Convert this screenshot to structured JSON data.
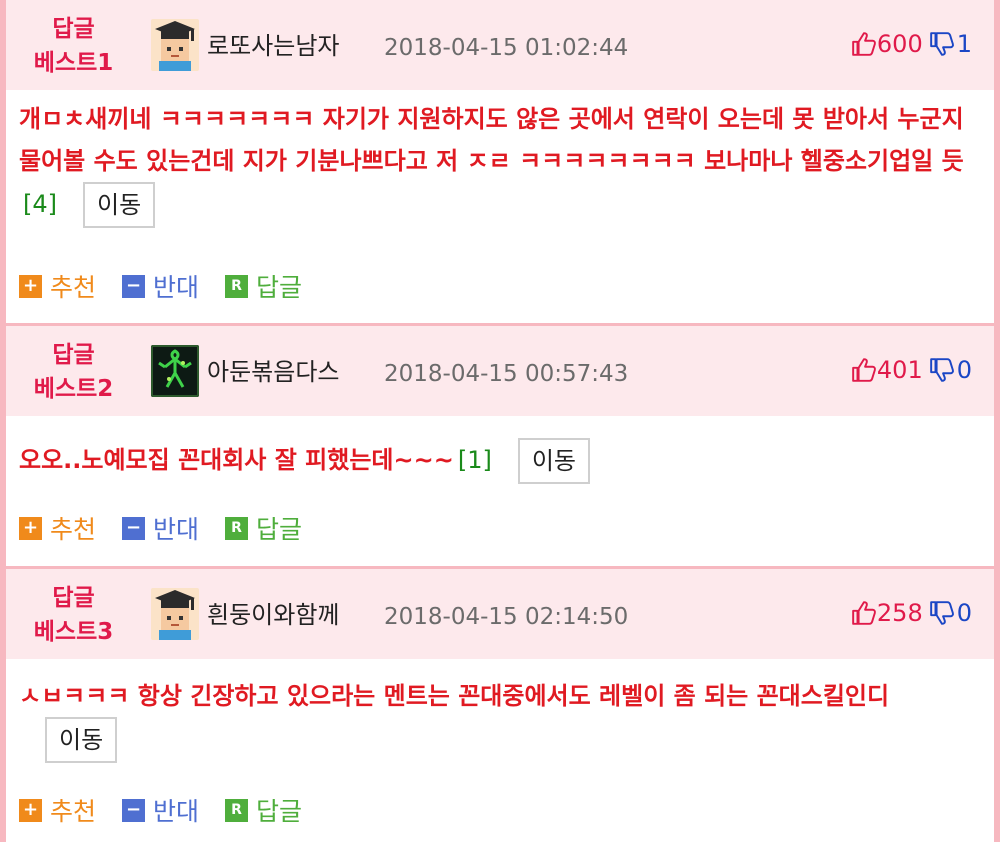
{
  "colors": {
    "badge": "#e01a4a",
    "comment_text": "#e01a22",
    "reply_count": "#1a8a1a",
    "recommend": "#f08a1b",
    "oppose": "#4f6fd1",
    "reply": "#4fae3c",
    "header_bg": "#fde9ec",
    "page_border": "#f7b8c0"
  },
  "actions": {
    "recommend_label": "추천",
    "recommend_icon": "+",
    "oppose_label": "반대",
    "oppose_icon": "−",
    "reply_label": "답글",
    "reply_icon": "R"
  },
  "move_label": "이동",
  "replies": [
    {
      "badge_line1": "답글",
      "badge_line2": "베스트1",
      "avatar": "graduate-avatar-icon",
      "nickname": "로또사는남자",
      "datetime": "2018-04-15 01:02:44",
      "up_count": "600",
      "down_count": "1",
      "text": "개ㅁㅊ새끼네 ㅋㅋㅋㅋㅋㅋㅋ 자기가 지원하지도 않은 곳에서 연락이 오는데 못 받아서 누군지 물어볼 수도 있는건데 지가 기분나쁘다고 저 ㅈㄹ ㅋㅋㅋㅋㅋㅋㅋㅋ 보나마나 헬중소기업일 듯",
      "reply_count": "[4]"
    },
    {
      "badge_line1": "답글",
      "badge_line2": "베스트2",
      "avatar": "green-figure-avatar-icon",
      "nickname": "아둔볶음다스",
      "datetime": "2018-04-15 00:57:43",
      "up_count": "401",
      "down_count": "0",
      "text": "오오..노예모집 꼰대회사 잘 피했는데~~~",
      "reply_count": "[1]"
    },
    {
      "badge_line1": "답글",
      "badge_line2": "베스트3",
      "avatar": "graduate-avatar-icon",
      "nickname": "흰둥이와함께",
      "datetime": "2018-04-15 02:14:50",
      "up_count": "258",
      "down_count": "0",
      "text": "ㅅㅂㅋㅋㅋ 항상 긴장하고 있으라는 멘트는 꼰대중에서도 레벨이 좀 되는 꼰대스킬인디",
      "reply_count": ""
    }
  ]
}
